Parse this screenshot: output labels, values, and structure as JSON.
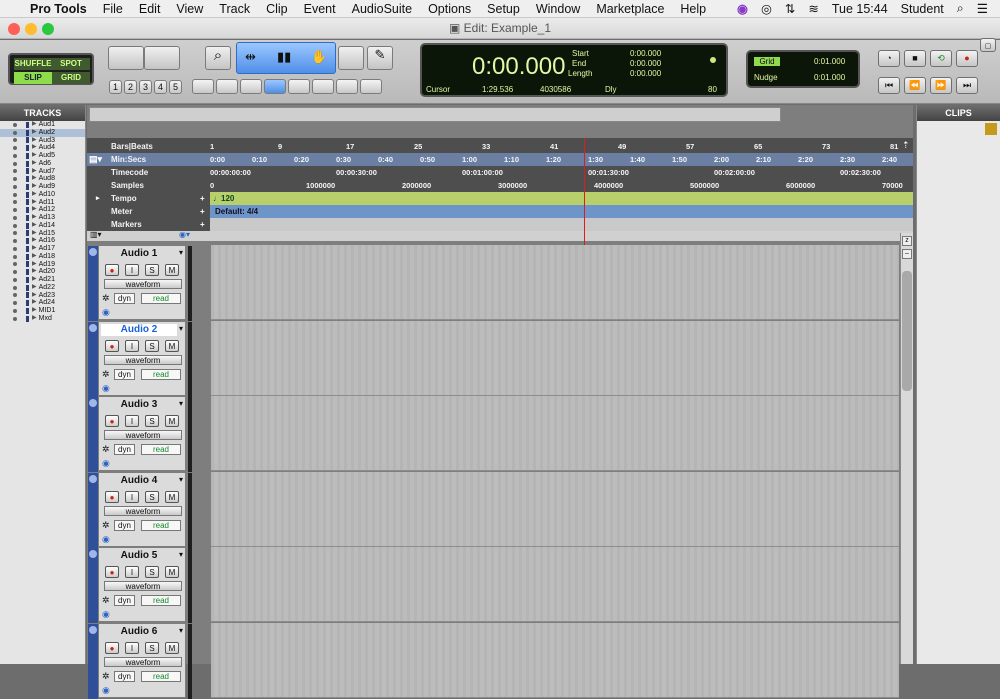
{
  "menubar": {
    "app": "Pro Tools",
    "items": [
      "File",
      "Edit",
      "View",
      "Track",
      "Clip",
      "Event",
      "AudioSuite",
      "Options",
      "Setup",
      "Window",
      "Marketplace",
      "Help"
    ],
    "time": "Tue 15:44",
    "user": "Student"
  },
  "window": {
    "title": "Edit: Example_1"
  },
  "toolbar": {
    "modes": {
      "shuffle": "SHUFFLE",
      "spot": "SPOT",
      "slip": "SLIP",
      "grid": "GRID"
    },
    "zoom_presets": [
      "1",
      "2",
      "3",
      "4",
      "5"
    ],
    "counter": {
      "main": "0:00.000",
      "start_label": "Start",
      "end_label": "End",
      "length_label": "Length",
      "start": "0:00.000",
      "end": "0:00.000",
      "length": "0:00.000",
      "cursor_label": "Cursor",
      "cursor": "1:29.536",
      "sample": "4030586",
      "dly": "Dly",
      "meter": "80"
    },
    "grid_label": "Grid",
    "grid_value": "0:01.000",
    "nudge_label": "Nudge",
    "nudge_value": "0:01.000"
  },
  "tracks_pane": {
    "header": "TRACKS",
    "items": [
      "Aud1",
      "Aud2",
      "Aud3",
      "Aud4",
      "Aud5",
      "Ad6",
      "Aud7",
      "Aud8",
      "Aud9",
      "Ad10",
      "Ad11",
      "Ad12",
      "Ad13",
      "Ad14",
      "Ad15",
      "Ad16",
      "Ad17",
      "Ad18",
      "Ad19",
      "Ad20",
      "Ad21",
      "Ad22",
      "Ad23",
      "Ad24",
      "MID1",
      "Mxd"
    ],
    "selected_index": 1
  },
  "clips_pane": {
    "header": "CLIPS"
  },
  "rulers": {
    "bars_label": "Bars|Beats",
    "bars": [
      "1",
      "9",
      "17",
      "25",
      "33",
      "41",
      "49",
      "57",
      "65",
      "73",
      "81"
    ],
    "minsecs_label": "Min:Secs",
    "minsecs": [
      "0:00",
      "0:10",
      "0:20",
      "0:30",
      "0:40",
      "0:50",
      "1:00",
      "1:10",
      "1:20",
      "1:30",
      "1:40",
      "1:50",
      "2:00",
      "2:10",
      "2:20",
      "2:30",
      "2:40"
    ],
    "timecode_label": "Timecode",
    "timecode": [
      "00:00:00:00",
      "00:00:30:00",
      "00:01:00:00",
      "00:01:30:00",
      "00:02:00:00",
      "00:02:30:00"
    ],
    "samples_label": "Samples",
    "samples": [
      "0",
      "1000000",
      "2000000",
      "3000000",
      "4000000",
      "5000000",
      "6000000",
      "70000"
    ],
    "tempo_label": "Tempo",
    "tempo_value": "120",
    "meter_label": "Meter",
    "meter_value": "Default: 4/4",
    "markers_label": "Markers"
  },
  "audio_tracks": [
    {
      "name": "Audio 1",
      "view": "waveform",
      "dyn": "dyn",
      "auto": "read",
      "rec": "●",
      "input": "I",
      "solo": "S",
      "mute": "M"
    },
    {
      "name": "Audio 2",
      "view": "waveform",
      "dyn": "dyn",
      "auto": "read",
      "rec": "●",
      "input": "I",
      "solo": "S",
      "mute": "M"
    },
    {
      "name": "Audio 3",
      "view": "waveform",
      "dyn": "dyn",
      "auto": "read",
      "rec": "●",
      "input": "I",
      "solo": "S",
      "mute": "M"
    },
    {
      "name": "Audio 4",
      "view": "waveform",
      "dyn": "dyn",
      "auto": "read",
      "rec": "●",
      "input": "I",
      "solo": "S",
      "mute": "M"
    },
    {
      "name": "Audio 5",
      "view": "waveform",
      "dyn": "dyn",
      "auto": "read",
      "rec": "●",
      "input": "I",
      "solo": "S",
      "mute": "M"
    },
    {
      "name": "Audio 6",
      "view": "waveform",
      "dyn": "dyn",
      "auto": "read",
      "rec": "●",
      "input": "I",
      "solo": "S",
      "mute": "M"
    }
  ],
  "colors": {
    "tempo_lane": "#b7d06b",
    "meter_lane": "#6e95c8",
    "playhead": "#d42020",
    "selected_track_text": "#1961d8"
  }
}
